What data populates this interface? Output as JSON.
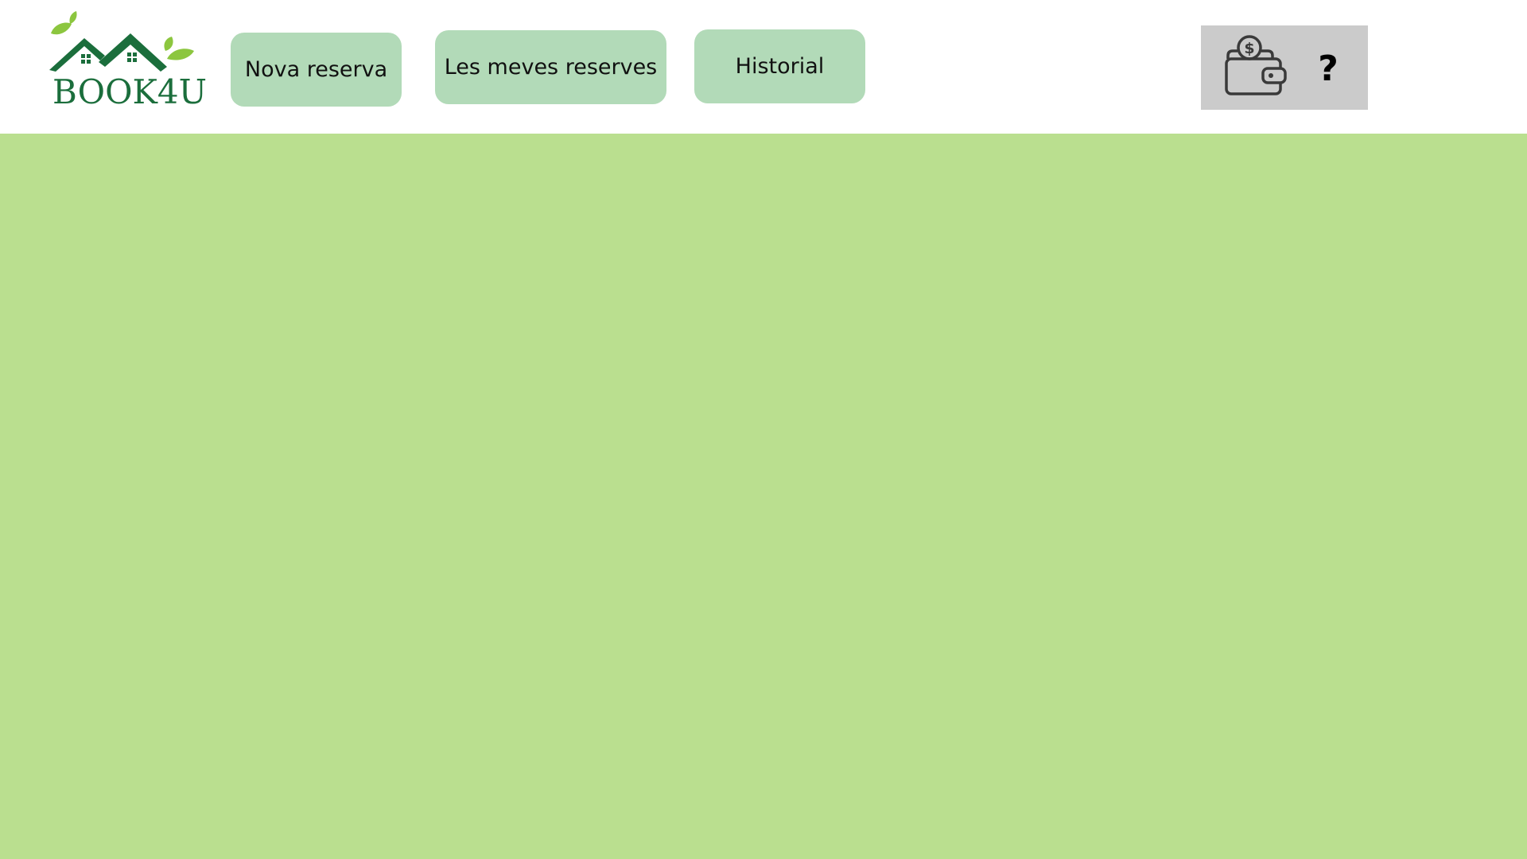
{
  "brand": {
    "name": "BOOK4U",
    "logo_icon": "houses-leaves-logo",
    "color_dark_green": "#1b6e3c",
    "color_leaf_green": "#8cc63f"
  },
  "nav": {
    "new_booking_label": "Nova reserva",
    "my_bookings_label": "Les meves reserves",
    "history_label": "Historial",
    "button_color": "#b2dab8"
  },
  "tools": {
    "wallet_icon": "wallet-icon",
    "help_label": "?",
    "background_color": "#cbcbcb"
  },
  "main": {
    "background_color": "#badf8f"
  }
}
